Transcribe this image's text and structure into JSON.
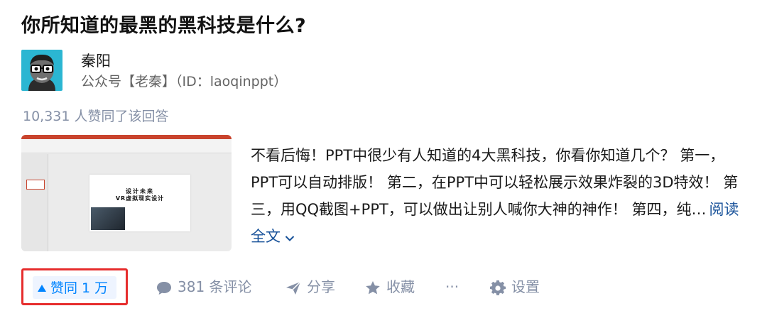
{
  "question": {
    "title": "你所知道的最黑的黑科技是什么?"
  },
  "author": {
    "name": "秦阳",
    "bio": "公众号【老秦】（ID：laoqinppt）"
  },
  "answer": {
    "upvote_text": "10,331 人赞同了该回答",
    "excerpt": "不看后悔！PPT中很少有人知道的4大黑科技，你看你知道几个？ 第一，PPT可以自动排版！ 第二，在PPT中可以轻松展示效果炸裂的3D特效！ 第三，用QQ截图+PPT，可以做出让别人喊你大神的神作！ 第四，纯…",
    "read_more": "阅读全文",
    "thumbnail": {
      "slide_title": "设计未来",
      "slide_subtitle": "VR虚拟现实设计"
    }
  },
  "actions": {
    "vote_label": "赞同 1 万",
    "comment_label": "381 条评论",
    "share_label": "分享",
    "favorite_label": "收藏",
    "more_label": "···",
    "settings_label": "设置"
  },
  "colors": {
    "accent": "#0084ff",
    "muted": "#8590a6",
    "link": "#175199",
    "highlight_border": "#e62d2d"
  }
}
